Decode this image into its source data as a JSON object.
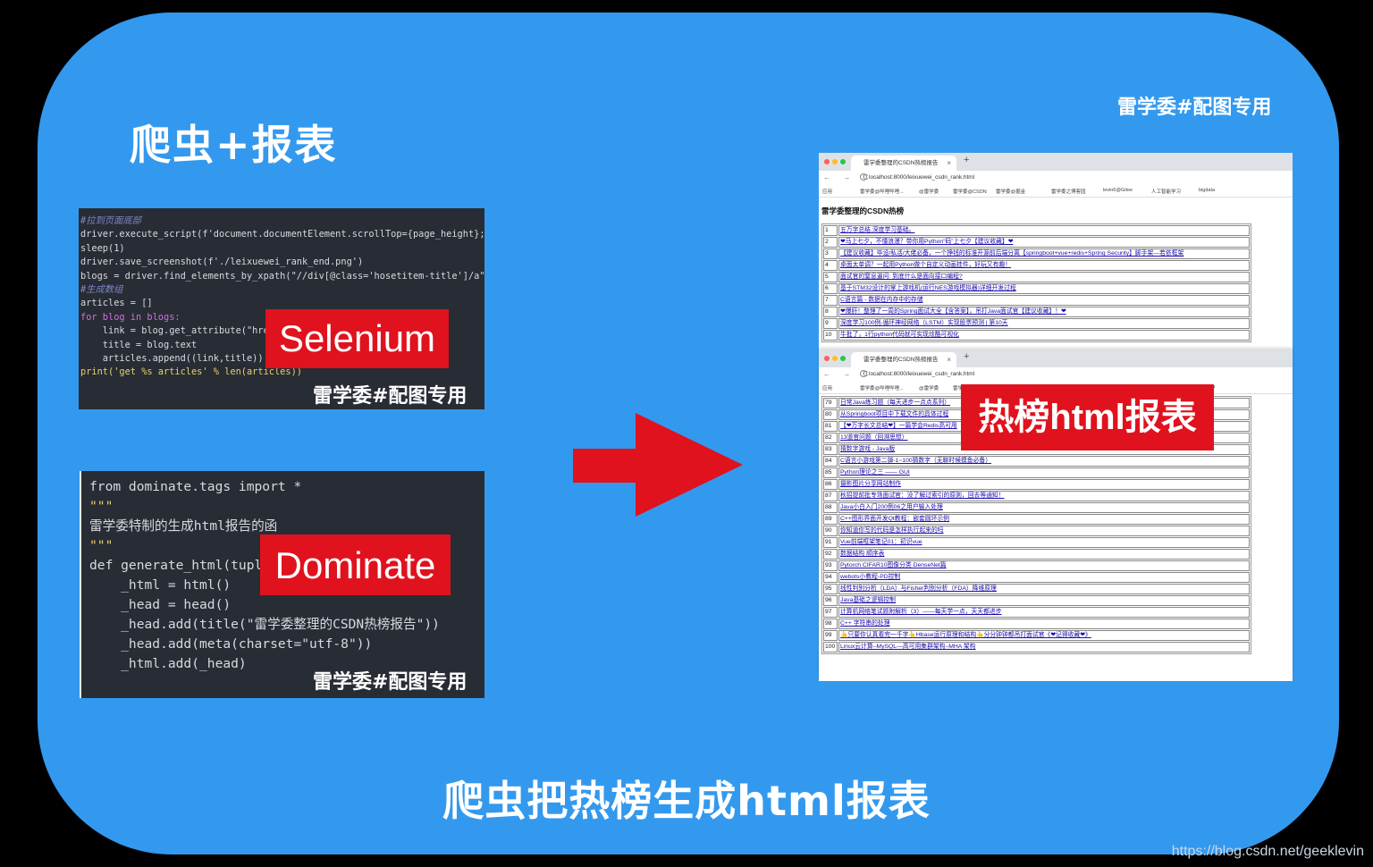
{
  "title": "爬虫+报表",
  "watermark": "雷学委#配图专用",
  "caption": "爬虫把热榜生成html报表",
  "source_url": "https://blog.csdn.net/geeklevin",
  "labels": {
    "selenium": "Selenium",
    "dominate": "Dominate",
    "hotlist": "热榜html报表"
  },
  "code1": [
    "#拉到页面底部",
    "driver.execute_script(f'document.documentElement.scrollTop={page_height};')",
    "sleep(1)",
    "driver.save_screenshot(f'./leixuewei_rank_end.png')",
    "blogs = driver.find_elements_by_xpath(\"//div[@class='hosetitem-title']/a\")",
    "",
    "#生成数组",
    "articles = []",
    "for blog in blogs:",
    "    link = blog.get_attribute(\"href",
    "    title = blog.text",
    "    articles.append((link,title))",
    "",
    "print('get %s articles' % len(articles))"
  ],
  "code2": [
    "from dominate.tags import *",
    "",
    "\"\"\"",
    "雷学委特制的生成html报告的函",
    "\"\"\"",
    "def generate_html(tuple",
    "    _html = html()",
    "    _head = head()",
    "    _head.add(title(\"雷学委整理的CSDN热榜报告\"))",
    "    _head.add(meta(charset=\"utf-8\"))",
    "    _html.add(_head)"
  ],
  "browser": {
    "tab_title": "雷学委整理的CSDN热榜报告",
    "tab_close": "×",
    "tab_plus": "+",
    "nav_icons": "← → C",
    "url": "localhost:8000/leixuewei_csdn_rank.html",
    "bookmarks": [
      "应用",
      "雷学委@哔哩哔哩...",
      "@雷学委",
      "雷学委@CSDN",
      "雷学委@掘金",
      "雷学委之博客园",
      "levin6@Gitee",
      "人工智能学习",
      "bigdata"
    ],
    "page_heading": "雷学委整理的CSDN热榜"
  },
  "rank_top": [
    {
      "n": "1",
      "t": "五万字总结,深度学习基础。"
    },
    {
      "n": "2",
      "t": "❤马上七夕，不懂浪漫？带你用Python“码”上七夕【建议收藏】❤"
    },
    {
      "n": "3",
      "t": "【建议收藏】毕设/私活/大佬必备，一个挣钱的标准开源前后端分离【springboot+vue+redis+Spring Security】脚手架—若依框架"
    },
    {
      "n": "4",
      "t": "桌面太单调？一起用Python做个自定义动画挂件，好玩又有趣！"
    },
    {
      "n": "5",
      "t": "面试官的窒息逼问: 到底什么是面向接口编程?"
    },
    {
      "n": "6",
      "t": "基于STM32设计的掌上游戏机(运行NES游戏模拟器)详细开发过程"
    },
    {
      "n": "7",
      "t": "C语言篇 - 数据在内存中的存储"
    },
    {
      "n": "8",
      "t": "❤爆肝！整理了一周的Spring面试大全【含答案】，吊打Java面试官【建议收藏】！❤"
    },
    {
      "n": "9",
      "t": "深度学习100例-循环神经网络（LSTM）实现股票预测 | 第10天"
    },
    {
      "n": "10",
      "t": "牛批了，1行python代码就可实现炫酷可视化"
    }
  ],
  "rank_bottom": [
    {
      "n": "79",
      "t": "日常Java练习题（每天进步一点点系列）"
    },
    {
      "n": "80",
      "t": "从Springboot项目中下载文件的具体过程"
    },
    {
      "n": "81",
      "t": "【❤万字长文总结❤】一篇学会Redis高可用"
    },
    {
      "n": "82",
      "t": "13道官问题（回溯思想）"
    },
    {
      "n": "83",
      "t": "猜数字游戏 - Java版"
    },
    {
      "n": "84",
      "t": "C语言小游戏第二弹-1~100猜数字（无聊时候摸鱼必备）"
    },
    {
      "n": "85",
      "t": "Python理论之三 —— GUI"
    },
    {
      "n": "86",
      "t": "摄影图片分享网站制作"
    },
    {
      "n": "87",
      "t": "秋招提前批专场面试官：没了解过索引的原则，回去等通知！"
    },
    {
      "n": "88",
      "t": "Java小白入门200例06之用户输入处理"
    },
    {
      "n": "89",
      "t": "C++图形界面开发Qt教程：嵌套圆环示例"
    },
    {
      "n": "90",
      "t": "你知道你写的代码是怎样执行起来的吗"
    },
    {
      "n": "91",
      "t": "Vue前端框架笔记01：初识vue"
    },
    {
      "n": "92",
      "t": "数据结构 顺序表"
    },
    {
      "n": "93",
      "t": "Pytorch CIFAR10图像分类 DenseNet篇"
    },
    {
      "n": "94",
      "t": "webots小教程-PD控制"
    },
    {
      "n": "95",
      "t": "线性判别分析（LDA）与Fisher判别分析（FDA）降维原理"
    },
    {
      "n": "96",
      "t": "Java基础之逻辑控制"
    },
    {
      "n": "97",
      "t": "计算机网络笔试题附解析（3）——每天学一点，天天都进步"
    },
    {
      "n": "98",
      "t": "C++ 字符串的处理"
    },
    {
      "n": "99",
      "t": "👆只要你认真看完一千字👆Hbase运行原理和结构👆分分钟钟都吊打面试官《❤记得收藏❤》"
    },
    {
      "n": "100",
      "t": "Linux云计算–MySQL—高可用集群架构–MHA 架构"
    }
  ],
  "colors": {
    "background": "#3399ee",
    "label_red": "#e0121e",
    "arrow_red": "#e0121e",
    "code_bg": "#282c34"
  }
}
